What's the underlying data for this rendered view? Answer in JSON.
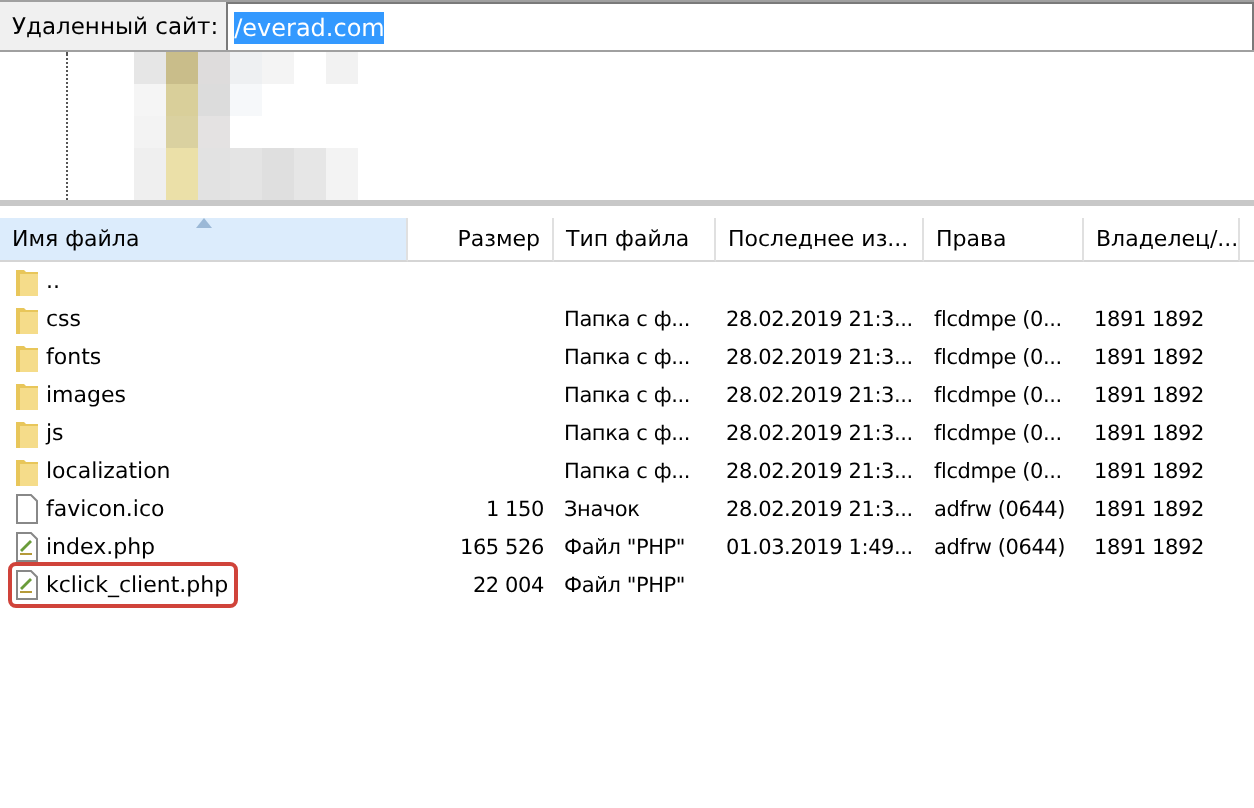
{
  "remote_site": {
    "label": "Удаленный сайт:",
    "path": "/everad.com",
    "path_selected": true
  },
  "table": {
    "columns": [
      {
        "label": "Имя файла",
        "sorted": true
      },
      {
        "label": "Размер",
        "sorted": false
      },
      {
        "label": "Тип файла",
        "sorted": false
      },
      {
        "label": "Последнее из...",
        "sorted": false
      },
      {
        "label": "Права",
        "sorted": false
      },
      {
        "label": "Владелец/...",
        "sorted": false
      }
    ],
    "rows": [
      {
        "kind": "folder",
        "name": "..",
        "size": "",
        "type": "",
        "modified": "",
        "rights": "",
        "owner": "",
        "highlighted": false
      },
      {
        "kind": "folder",
        "name": "css",
        "size": "",
        "type": "Папка с ф...",
        "modified": "28.02.2019 21:3...",
        "rights": "flcdmpe (0...",
        "owner": "1891 1892",
        "highlighted": false
      },
      {
        "kind": "folder",
        "name": "fonts",
        "size": "",
        "type": "Папка с ф...",
        "modified": "28.02.2019 21:3...",
        "rights": "flcdmpe (0...",
        "owner": "1891 1892",
        "highlighted": false
      },
      {
        "kind": "folder",
        "name": "images",
        "size": "",
        "type": "Папка с ф...",
        "modified": "28.02.2019 21:3...",
        "rights": "flcdmpe (0...",
        "owner": "1891 1892",
        "highlighted": false
      },
      {
        "kind": "folder",
        "name": "js",
        "size": "",
        "type": "Папка с ф...",
        "modified": "28.02.2019 21:3...",
        "rights": "flcdmpe (0...",
        "owner": "1891 1892",
        "highlighted": false
      },
      {
        "kind": "folder",
        "name": "localization",
        "size": "",
        "type": "Папка с ф...",
        "modified": "28.02.2019 21:3...",
        "rights": "flcdmpe (0...",
        "owner": "1891 1892",
        "highlighted": false
      },
      {
        "kind": "file",
        "name": "favicon.ico",
        "size": "1 150",
        "type": "Значок",
        "modified": "28.02.2019 21:3...",
        "rights": "adfrw (0644)",
        "owner": "1891 1892",
        "highlighted": false
      },
      {
        "kind": "script",
        "name": "index.php",
        "size": "165 526",
        "type": "Файл \"PHP\"",
        "modified": "01.03.2019 1:49...",
        "rights": "adfrw (0644)",
        "owner": "1891 1892",
        "highlighted": false
      },
      {
        "kind": "script",
        "name": "kclick_client.php",
        "size": "22 004",
        "type": "Файл \"PHP\"",
        "modified": "",
        "rights": "",
        "owner": "",
        "highlighted": true
      }
    ]
  }
}
